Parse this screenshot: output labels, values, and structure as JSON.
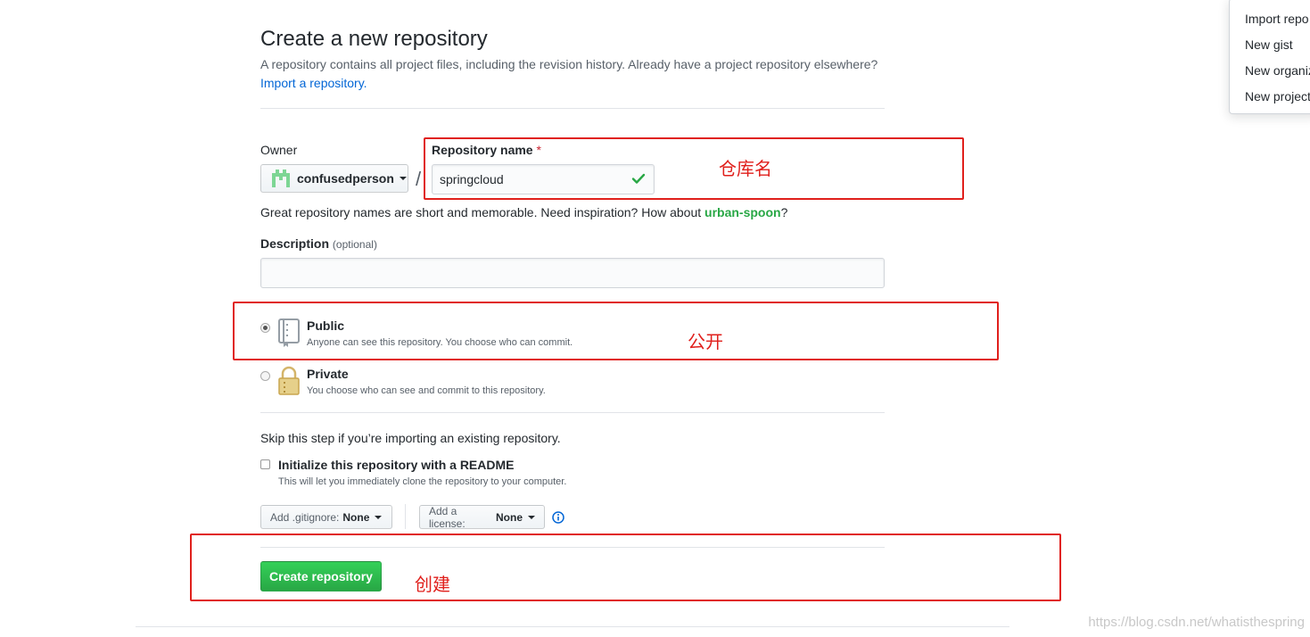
{
  "header": {
    "title": "Create a new repository",
    "subtitle": "A repository contains all project files, including the revision history. Already have a project repository elsewhere?",
    "import_link": "Import a repository."
  },
  "owner": {
    "label": "Owner",
    "value": "confusedperson"
  },
  "repo_name": {
    "label": "Repository name",
    "required_mark": "*",
    "value": "springcloud",
    "hint_prefix": "Great repository names are short and memorable. Need inspiration? How about ",
    "hint_suggestion": "urban-spoon",
    "hint_suffix": "?"
  },
  "description": {
    "label": "Description",
    "optional": "(optional)",
    "value": ""
  },
  "visibility": {
    "public_title": "Public",
    "public_note": "Anyone can see this repository. You choose who can commit.",
    "private_title": "Private",
    "private_note": "You choose who can see and commit to this repository.",
    "selected": "Public"
  },
  "init": {
    "skip_note": "Skip this step if you’re importing an existing repository.",
    "readme_label": "Initialize this repository with a README",
    "readme_note": "This will let you immediately clone the repository to your computer.",
    "readme_checked": false
  },
  "options": {
    "gitignore_label": "Add .gitignore:",
    "gitignore_value": "None",
    "license_label": "Add a license:",
    "license_value": "None"
  },
  "actions": {
    "create_label": "Create repository"
  },
  "annotations": {
    "repo_name_note": "仓库名",
    "public_note": "公开",
    "create_note": "创建"
  },
  "dropdown_menu": {
    "items": [
      "Import repo",
      "New gist",
      "New organiz",
      "New project"
    ]
  },
  "watermark": "https://blog.csdn.net/whatisthespring",
  "colors": {
    "annotation_red": "#e0201c",
    "link_blue": "#0366d6",
    "create_green": "#28a745"
  }
}
